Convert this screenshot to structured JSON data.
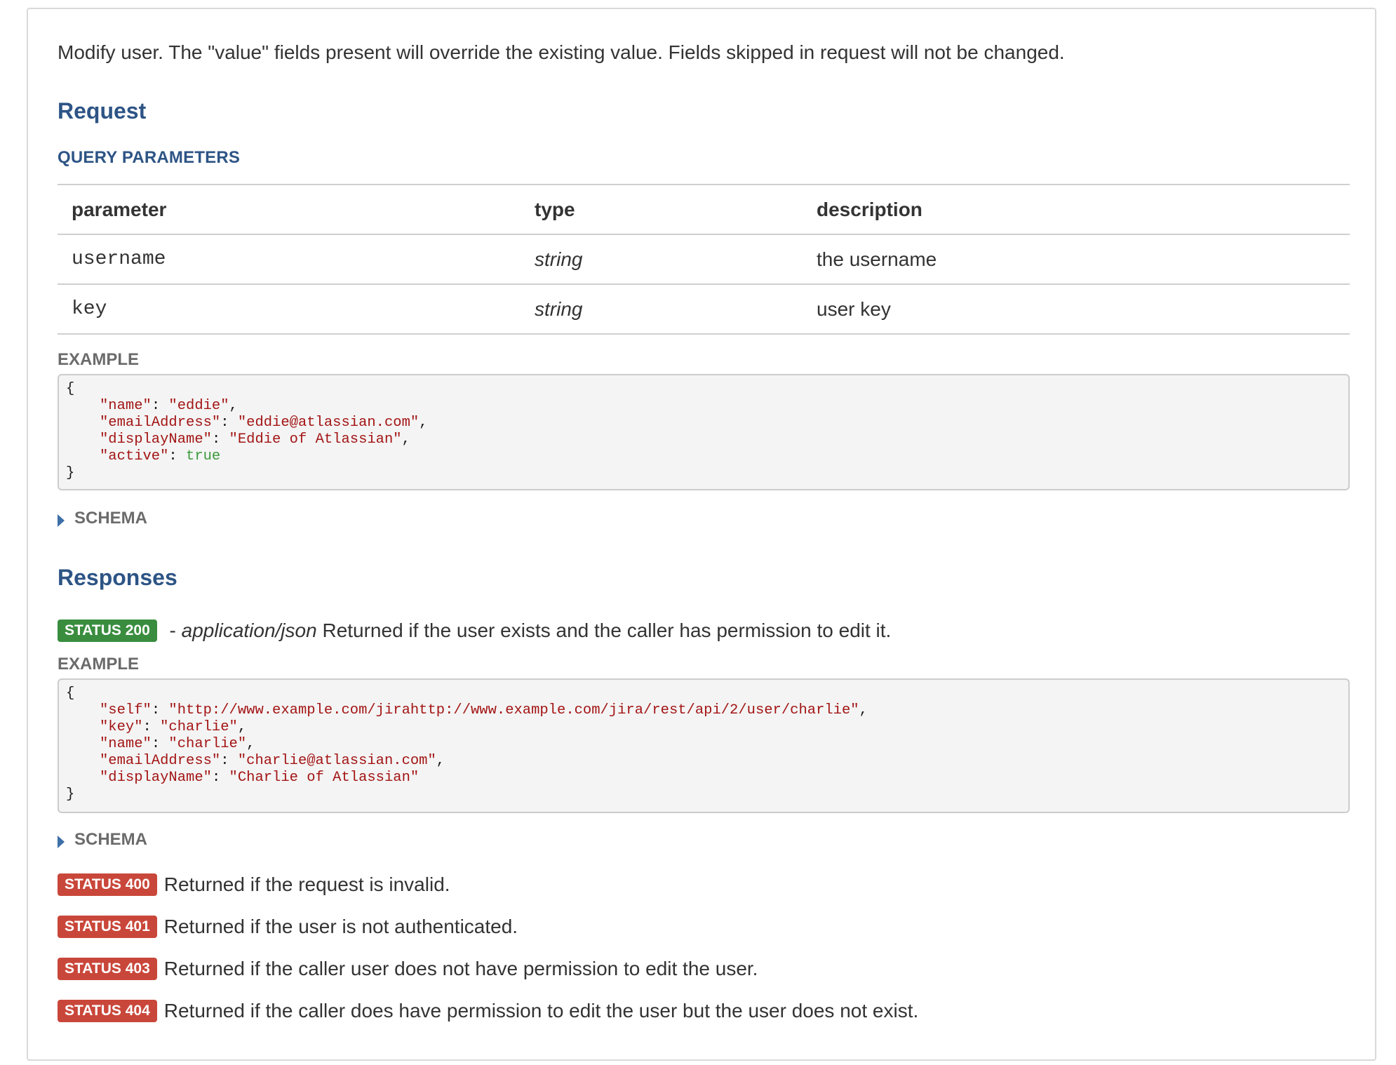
{
  "intro": "Modify user. The \"value\" fields present will override the existing value. Fields skipped in request will not be changed.",
  "request": {
    "heading": "Request",
    "query_heading": "QUERY PARAMETERS",
    "table": {
      "headers": [
        "parameter",
        "type",
        "description"
      ],
      "rows": [
        {
          "parameter": "username",
          "type": "string",
          "description": "the username"
        },
        {
          "parameter": "key",
          "type": "string",
          "description": "user key"
        }
      ]
    },
    "example_label": "EXAMPLE",
    "example_lines": [
      [
        "{"
      ],
      [
        "\"name\"",
        ": ",
        "\"eddie\"",
        ","
      ],
      [
        "\"emailAddress\"",
        ": ",
        "\"eddie@atlassian.com\"",
        ","
      ],
      [
        "\"displayName\"",
        ": ",
        "\"Eddie of Atlassian\"",
        ","
      ],
      [
        "\"active\"",
        ": ",
        "true",
        ""
      ],
      [
        "}"
      ]
    ],
    "schema_label": "SCHEMA"
  },
  "responses": {
    "heading": "Responses",
    "status_200": {
      "badge": "STATUS 200",
      "dash": " - ",
      "media": "application/json",
      "text": " Returned if the user exists and the caller has permission to edit it."
    },
    "example_label": "EXAMPLE",
    "example_lines": [
      [
        "{"
      ],
      [
        "\"self\"",
        ": ",
        "\"http://www.example.com/jirahttp://www.example.com/jira/rest/api/2/user/charlie\"",
        ","
      ],
      [
        "\"key\"",
        ": ",
        "\"charlie\"",
        ","
      ],
      [
        "\"name\"",
        ": ",
        "\"charlie\"",
        ","
      ],
      [
        "\"emailAddress\"",
        ": ",
        "\"charlie@atlassian.com\"",
        ","
      ],
      [
        "\"displayName\"",
        ": ",
        "\"Charlie of Atlassian\"",
        ""
      ],
      [
        "}"
      ]
    ],
    "schema_label": "SCHEMA",
    "errors": [
      {
        "badge": "STATUS 400",
        "text": "Returned if the request is invalid."
      },
      {
        "badge": "STATUS 401",
        "text": "Returned if the user is not authenticated."
      },
      {
        "badge": "STATUS 403",
        "text": "Returned if the caller user does not have permission to edit the user."
      },
      {
        "badge": "STATUS 404",
        "text": "Returned if the caller does have permission to edit the user but the user does not exist."
      }
    ]
  },
  "colors": {
    "heading": "#2d5485",
    "status_ok": "#3a8d3f",
    "status_error": "#c9473a",
    "json_string": "#a31515",
    "json_bool": "#3a9a3a"
  }
}
